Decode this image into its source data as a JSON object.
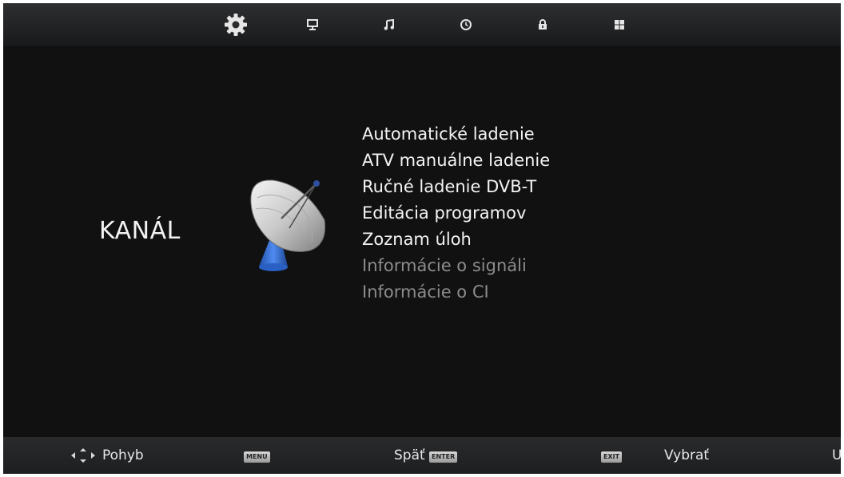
{
  "top_tabs": [
    {
      "id": "setup",
      "icon": "gear-icon",
      "selected": true
    },
    {
      "id": "picture",
      "icon": "monitor-icon",
      "selected": false
    },
    {
      "id": "sound",
      "icon": "music-note-icon",
      "selected": false
    },
    {
      "id": "time",
      "icon": "clock-icon",
      "selected": false
    },
    {
      "id": "lock",
      "icon": "lock-icon",
      "selected": false
    },
    {
      "id": "app",
      "icon": "grid-icon",
      "selected": false
    }
  ],
  "category": {
    "title": "KANÁL",
    "icon": "satellite-dish-icon"
  },
  "menu": {
    "items": [
      {
        "label": "Automatické ladenie",
        "enabled": true
      },
      {
        "label": "ATV manuálne ladenie",
        "enabled": true
      },
      {
        "label": "Ručné ladenie DVB-T",
        "enabled": true
      },
      {
        "label": "Editácia programov",
        "enabled": true
      },
      {
        "label": "Zoznam úloh",
        "enabled": true
      },
      {
        "label": "Informácie o signáli",
        "enabled": false
      },
      {
        "label": "Informácie o CI",
        "enabled": false
      }
    ]
  },
  "footer": {
    "move_label": "Pohyb",
    "menu_key": "MENU",
    "back_label": "Späť",
    "enter_key": "ENTER",
    "exit_key": "EXIT",
    "select_label": "Vybrať",
    "cut_label": "U"
  },
  "colors": {
    "background": "#111112",
    "text": "#f4f4f4",
    "disabled_text": "#8c8c8c",
    "dish_base": "#2f6fd6"
  }
}
